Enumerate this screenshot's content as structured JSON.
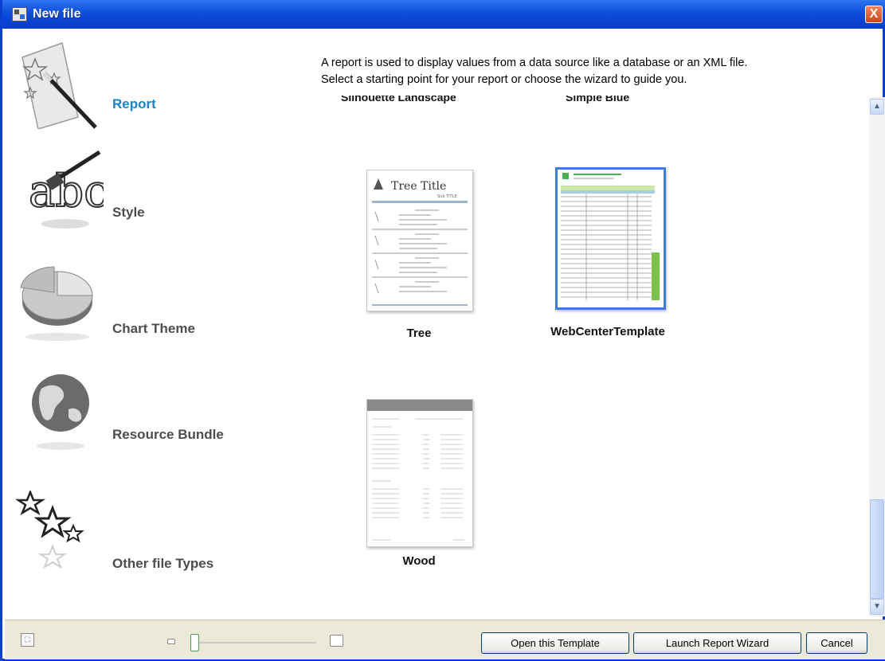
{
  "window": {
    "title": "New file",
    "close_label": "X"
  },
  "sidebar": {
    "items": [
      {
        "label": "Report",
        "icon": "report-wand-icon",
        "active": true
      },
      {
        "label": "Style",
        "icon": "style-brush-icon",
        "active": false
      },
      {
        "label": "Chart Theme",
        "icon": "pie-chart-icon",
        "active": false
      },
      {
        "label": "Resource Bundle",
        "icon": "globe-icon",
        "active": false
      },
      {
        "label": "Other file Types",
        "icon": "stars-icon",
        "active": false
      }
    ]
  },
  "main": {
    "description_line1": "A report is used to display values from a data source like a database or an XML file.",
    "description_line2": "Select a starting point for your report or choose the wizard to guide you.",
    "templates": [
      {
        "label": "Silhouette Landscape",
        "partially_visible": true
      },
      {
        "label": "Simple Blue",
        "partially_visible": true
      },
      {
        "label": "Tree",
        "thumbnail_title": "Tree Title",
        "thumbnail_subtitle": "Sub TITLE"
      },
      {
        "label": "WebCenterTemplate",
        "selected": true
      },
      {
        "label": "Wood"
      }
    ]
  },
  "footer": {
    "open_button": "Open this Template",
    "wizard_button": "Launch Report Wizard",
    "cancel_button": "Cancel",
    "fit_icon": "fit-to-window-icon"
  },
  "colors": {
    "active_sidebar": "#1585c8",
    "titlebar": "#0a4fd6",
    "selection": "#3d7cda"
  }
}
